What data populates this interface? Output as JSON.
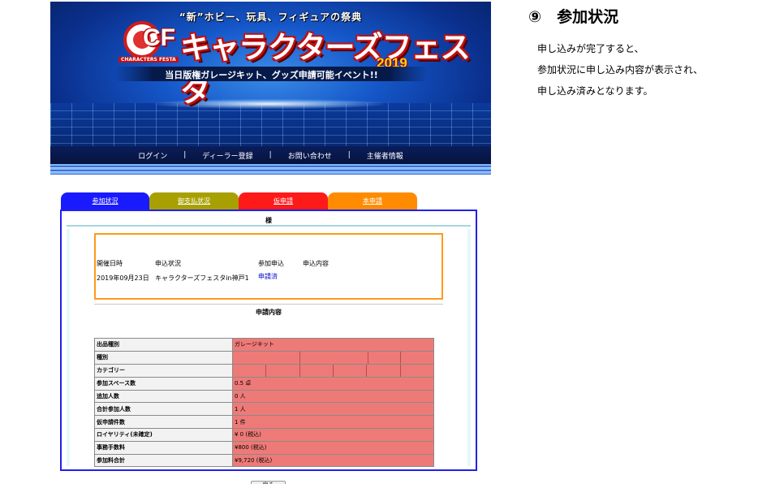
{
  "banner": {
    "tagline": "“新”ホビー、玩具、フィギュアの祭典",
    "logo_text": "CF",
    "logo_small": "CHARACTERS FESTA",
    "title": "キャラクターズフェスタ",
    "year": "2019",
    "subtitle": "当日版権ガレージキット、グッズ申請可能イベント!!",
    "nav": [
      {
        "label": "ログイン"
      },
      {
        "label": "ディーラー登録"
      },
      {
        "label": "お問い合わせ"
      },
      {
        "label": "主催者情報"
      }
    ],
    "nav_separator": "|"
  },
  "tabs": [
    {
      "label": "参加状況",
      "color": "#1a1aff"
    },
    {
      "label": "御支払状況",
      "color": "#a8a000"
    },
    {
      "label": "仮申請",
      "color": "#ff1a1a"
    },
    {
      "label": "本申請",
      "color": "#ff8c00"
    }
  ],
  "panel": {
    "honorific": "様"
  },
  "status_table": {
    "headers": [
      "開催日時",
      "申込状況",
      "参加申込",
      "申込内容"
    ],
    "row": {
      "date": "2019年09月23日",
      "event": "キャラクターズフェスタin神戸1",
      "status_link": "申請済"
    }
  },
  "section_title": "申請内容",
  "details": [
    {
      "label": "出品種別",
      "value": "ガレージキット"
    },
    {
      "label": "種別",
      "value": ""
    },
    {
      "label": "カテゴリー",
      "value": ""
    },
    {
      "label": "参加スペース数",
      "value": "0.5 卓"
    },
    {
      "label": "追加人数",
      "value": "0 人"
    },
    {
      "label": "合計参加人数",
      "value": "1 人"
    },
    {
      "label": "仮申請件数",
      "value": "1 件"
    },
    {
      "label": "ロイヤリティ(未確定)",
      "value": "¥ 0 (税込)"
    },
    {
      "label": "事務手数料",
      "value": "¥800 (税込)"
    },
    {
      "label": "参加料合計",
      "value": "¥9,720 (税込)"
    }
  ],
  "return_button": "戻る",
  "instructions": {
    "step_title": "⑨　参加状況",
    "lines": [
      "申し込みが完了すると、",
      "参加状況に申し込み内容が表示され、",
      "申し込み済みとなります。"
    ]
  }
}
